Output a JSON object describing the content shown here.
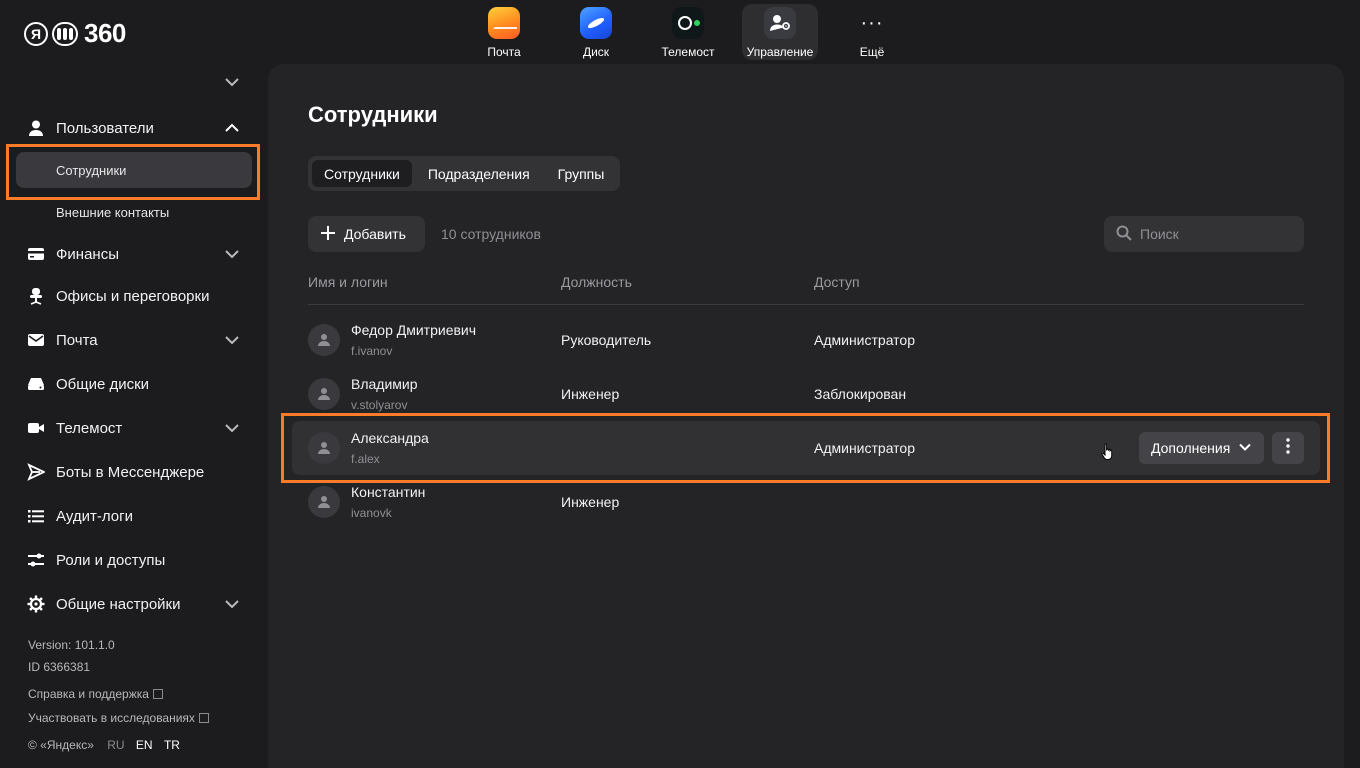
{
  "logo": {
    "text": "360"
  },
  "apps": [
    {
      "label": "Почта",
      "icon": "mail-app-icon",
      "active": false
    },
    {
      "label": "Диск",
      "icon": "disk-app-icon",
      "active": false
    },
    {
      "label": "Телемост",
      "icon": "telemost-app-icon",
      "active": false
    },
    {
      "label": "Управление",
      "icon": "admin-app-icon",
      "active": true
    },
    {
      "label": "Ещё",
      "icon": "more-dots-icon",
      "active": false
    }
  ],
  "sidebar": {
    "users": "Пользователи",
    "employees": "Сотрудники",
    "external": "Внешние контакты",
    "finance": "Финансы",
    "offices": "Офисы и переговорки",
    "mail": "Почта",
    "disks": "Общие диски",
    "telemost": "Телемост",
    "bots": "Боты в Мессенджере",
    "audit": "Аудит-логи",
    "roles": "Роли и доступы",
    "settings": "Общие настройки",
    "version": "Version: 101.1.0",
    "id": "ID 6366381",
    "help": "Справка и поддержка",
    "research": "Участвовать в исследованиях",
    "copyright": "© «Яндекс»",
    "lang_ru": "RU",
    "lang_en": "EN",
    "lang_tr": "TR"
  },
  "main": {
    "title": "Сотрудники",
    "tabs": [
      "Сотрудники",
      "Подразделения",
      "Группы"
    ],
    "add_label": "Добавить",
    "count": "10 сотрудников",
    "search_placeholder": "Поиск",
    "columns": [
      "Имя и логин",
      "Должность",
      "Доступ"
    ],
    "rows": [
      {
        "name": "Федор Дмитриевич",
        "login": "f.ivanov",
        "position": "Руководитель",
        "access": "Администратор"
      },
      {
        "name": "Владимир",
        "login": "v.stolyarov",
        "position": "Инженер",
        "access": "Заблокирован"
      },
      {
        "name": "Александра",
        "login": "f.alex",
        "position": "",
        "access": "Администратор"
      },
      {
        "name": "Константин",
        "login": "ivanovk",
        "position": "Инженер",
        "access": ""
      }
    ],
    "more_label": "Дополнения"
  },
  "colors": {
    "highlight": "#ff7a29",
    "panel": "#242427",
    "background": "#1c1c1e"
  }
}
